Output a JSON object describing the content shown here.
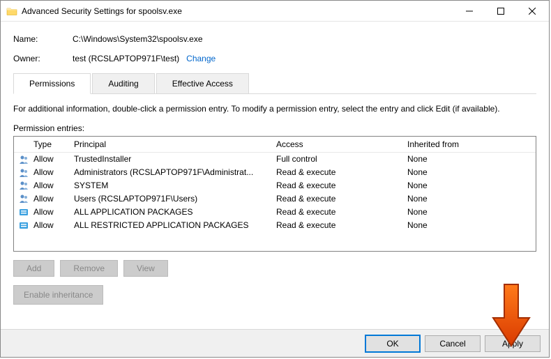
{
  "window": {
    "title": "Advanced Security Settings for spoolsv.exe"
  },
  "info": {
    "name_label": "Name:",
    "name_value": "C:\\Windows\\System32\\spoolsv.exe",
    "owner_label": "Owner:",
    "owner_value": "test (RCSLAPTOP971F\\test)",
    "change_label": "Change"
  },
  "tabs": {
    "permissions": "Permissions",
    "auditing": "Auditing",
    "effective": "Effective Access"
  },
  "description": "For additional information, double-click a permission entry. To modify a permission entry, select the entry and click Edit (if available).",
  "entries_label": "Permission entries:",
  "columns": {
    "type": "Type",
    "principal": "Principal",
    "access": "Access",
    "inherited": "Inherited from"
  },
  "entries": [
    {
      "type": "Allow",
      "principal": "TrustedInstaller",
      "access": "Full control",
      "inherited": "None",
      "icon": "user"
    },
    {
      "type": "Allow",
      "principal": "Administrators (RCSLAPTOP971F\\Administrat...",
      "access": "Read & execute",
      "inherited": "None",
      "icon": "group"
    },
    {
      "type": "Allow",
      "principal": "SYSTEM",
      "access": "Read & execute",
      "inherited": "None",
      "icon": "group"
    },
    {
      "type": "Allow",
      "principal": "Users (RCSLAPTOP971F\\Users)",
      "access": "Read & execute",
      "inherited": "None",
      "icon": "group"
    },
    {
      "type": "Allow",
      "principal": "ALL APPLICATION PACKAGES",
      "access": "Read & execute",
      "inherited": "None",
      "icon": "pkg"
    },
    {
      "type": "Allow",
      "principal": "ALL RESTRICTED APPLICATION PACKAGES",
      "access": "Read & execute",
      "inherited": "None",
      "icon": "pkg"
    }
  ],
  "buttons": {
    "add": "Add",
    "remove": "Remove",
    "view": "View",
    "enable_inheritance": "Enable inheritance",
    "ok": "OK",
    "cancel": "Cancel",
    "apply": "Apply"
  }
}
